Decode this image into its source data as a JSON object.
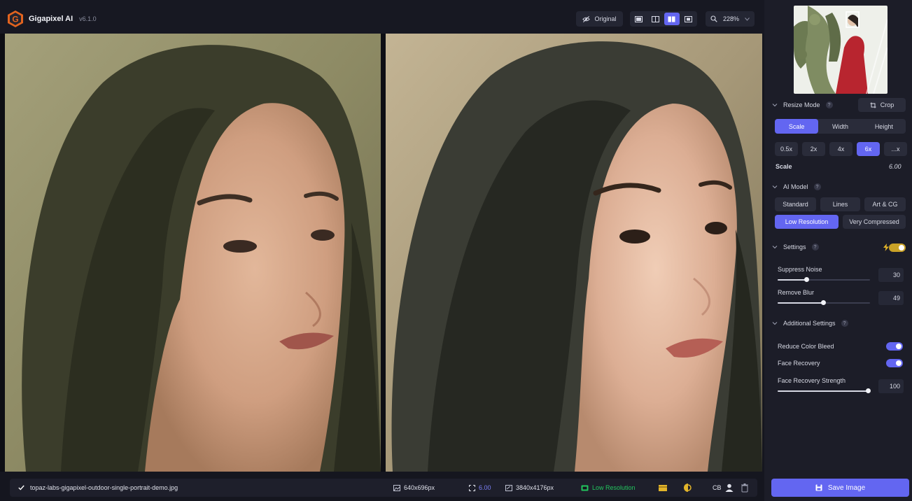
{
  "app": {
    "name": "Gigapixel AI",
    "version": "v6.1.0"
  },
  "toolbar": {
    "original_label": "Original",
    "zoom_label": "228%"
  },
  "file": {
    "name": "topaz-labs-gigapixel-outdoor-single-portrait-demo.jpg",
    "input_size": "640x696px",
    "scale": "6.00",
    "output_size": "3840x4176px",
    "model": "Low Resolution",
    "cb_label": "CB"
  },
  "panel": {
    "resize_mode": {
      "title": "Resize Mode",
      "crop_label": "Crop",
      "tabs": [
        "Scale",
        "Width",
        "Height"
      ],
      "active_tab": "Scale",
      "presets": [
        "0.5x",
        "2x",
        "4x",
        "6x",
        "...x"
      ],
      "active_preset": "6x",
      "scale_label": "Scale",
      "scale_value": "6.00"
    },
    "ai_model": {
      "title": "AI Model",
      "row1": [
        "Standard",
        "Lines",
        "Art & CG"
      ],
      "row2": [
        "Low Resolution",
        "Very Compressed"
      ],
      "active": "Low Resolution"
    },
    "settings": {
      "title": "Settings",
      "suppress_noise_label": "Suppress Noise",
      "suppress_noise_value": "30",
      "remove_blur_label": "Remove Blur",
      "remove_blur_value": "49"
    },
    "additional": {
      "title": "Additional Settings",
      "reduce_color_bleed": "Reduce Color Bleed",
      "face_recovery": "Face Recovery",
      "face_recovery_strength_label": "Face Recovery Strength",
      "face_recovery_strength_value": "100"
    },
    "save_label": "Save Image"
  },
  "colors": {
    "accent": "#6366f1",
    "panel_bg": "#1c1d28",
    "success": "#22c55e"
  },
  "icons": [
    "gigapixel-logo",
    "eye-off-icon",
    "single-view-icon",
    "split-view-icon",
    "side-by-side-icon",
    "compare-icon",
    "zoom-icon",
    "chevron-down-icon",
    "crop-icon",
    "bolt-icon",
    "save-icon",
    "check-icon",
    "trash-icon"
  ]
}
